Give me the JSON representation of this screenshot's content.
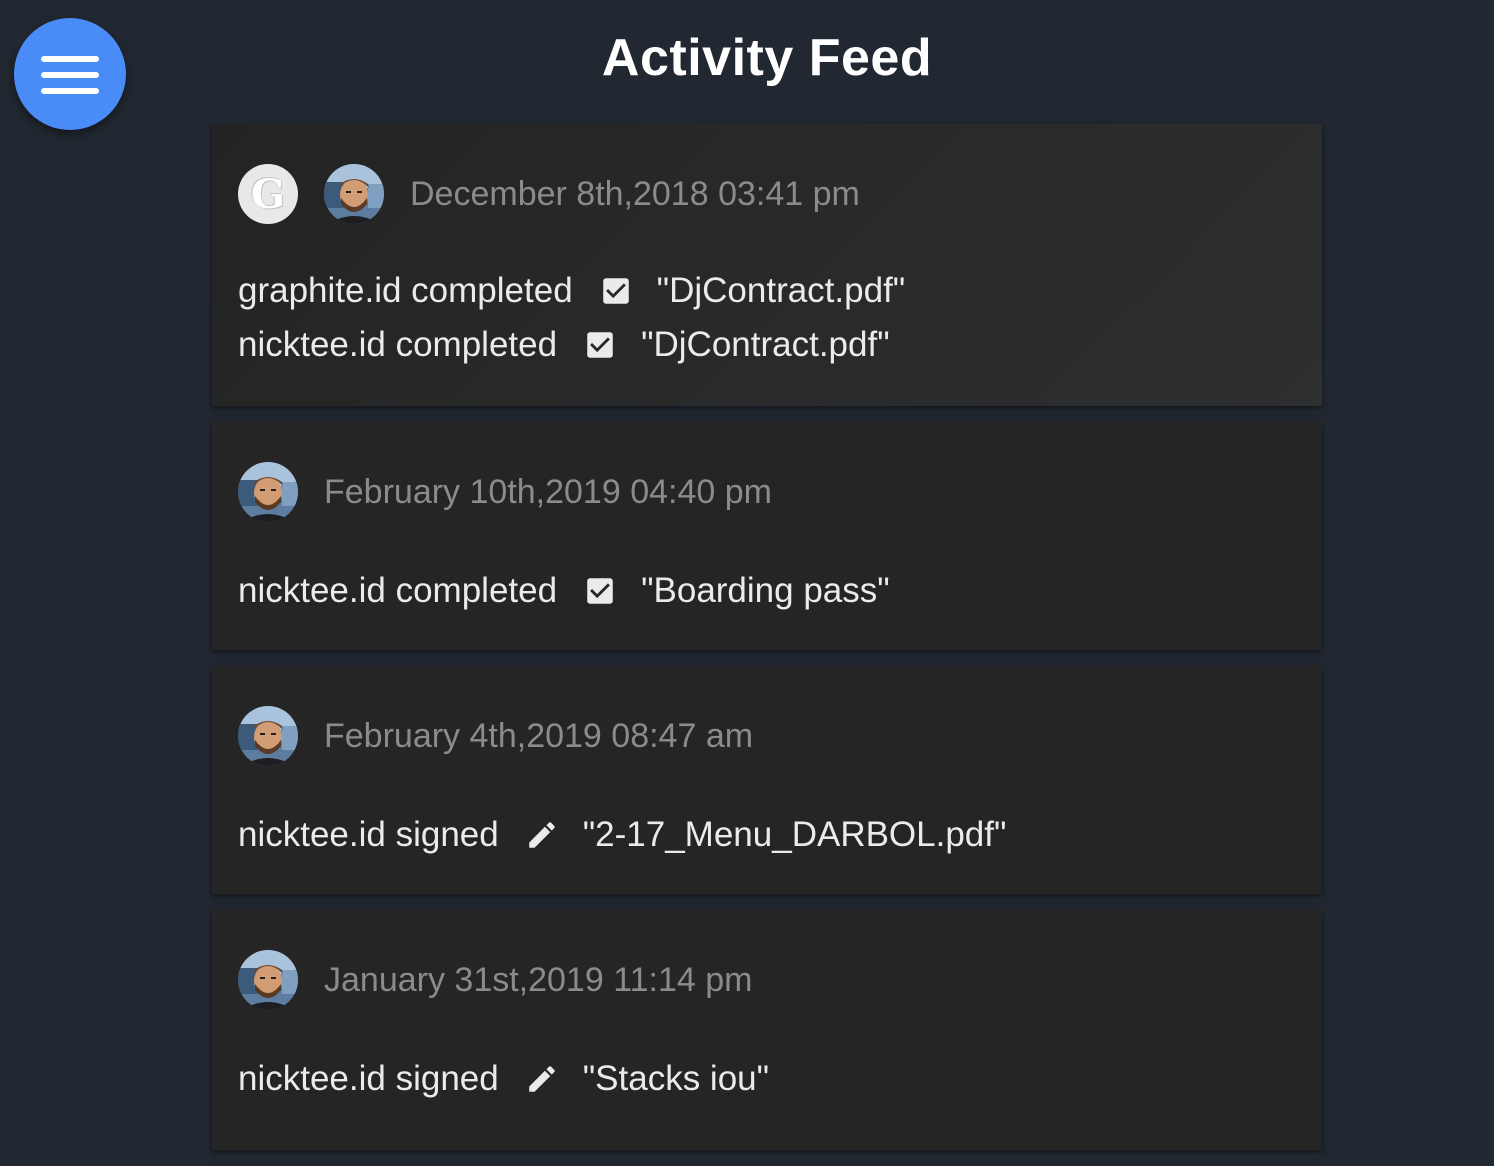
{
  "header": {
    "title": "Activity Feed",
    "menu_icon": "hamburger-menu-icon",
    "menu_color": "#4a8cf7"
  },
  "feed": [
    {
      "timestamp": "December 8th,2018 03:41 pm",
      "avatars": [
        "graphite-logo-avatar",
        "user-photo-avatar"
      ],
      "logo_letter": "G",
      "activities": [
        {
          "actor": "graphite.id completed",
          "icon": "checkbox-checked-icon",
          "document": "\"DjContract.pdf\""
        },
        {
          "actor": "nicktee.id completed",
          "icon": "checkbox-checked-icon",
          "document": "\"DjContract.pdf\""
        }
      ]
    },
    {
      "timestamp": "February 10th,2019 04:40 pm",
      "avatars": [
        "user-photo-avatar"
      ],
      "activities": [
        {
          "actor": "nicktee.id completed",
          "icon": "checkbox-checked-icon",
          "document": "\"Boarding pass\""
        }
      ]
    },
    {
      "timestamp": "February 4th,2019 08:47 am",
      "avatars": [
        "user-photo-avatar"
      ],
      "activities": [
        {
          "actor": "nicktee.id signed",
          "icon": "pencil-icon",
          "document": "\"2-17_Menu_DARBOL.pdf\""
        }
      ]
    },
    {
      "timestamp": "January 31st,2019 11:14 pm",
      "avatars": [
        "user-photo-avatar"
      ],
      "activities": [
        {
          "actor": "nicktee.id signed",
          "icon": "pencil-icon",
          "document": "\"Stacks iou\""
        }
      ]
    }
  ]
}
